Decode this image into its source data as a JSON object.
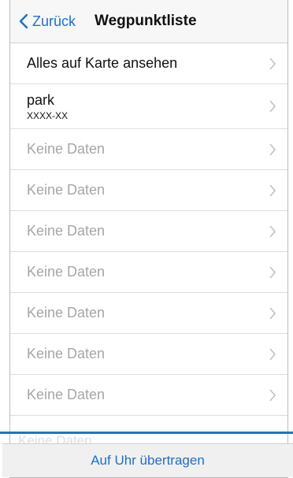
{
  "nav": {
    "back_label": "Zurück",
    "title": "Wegpunktliste"
  },
  "rows": [
    {
      "label": "Alles auf Karte ansehen"
    },
    {
      "label": "park",
      "sub": "XXXX-XX"
    },
    {
      "label": "Keine Daten"
    },
    {
      "label": "Keine Daten"
    },
    {
      "label": "Keine Daten"
    },
    {
      "label": "Keine Daten"
    },
    {
      "label": "Keine Daten"
    },
    {
      "label": "Keine Daten"
    },
    {
      "label": "Keine Daten"
    }
  ],
  "footer": {
    "faded_row_label": "Keine Daten",
    "button_label": "Auf Uhr übertragen"
  },
  "colors": {
    "accent": "#1f6fc4",
    "highlight": "#2e6fb8",
    "muted_text": "#a6a6a6"
  }
}
